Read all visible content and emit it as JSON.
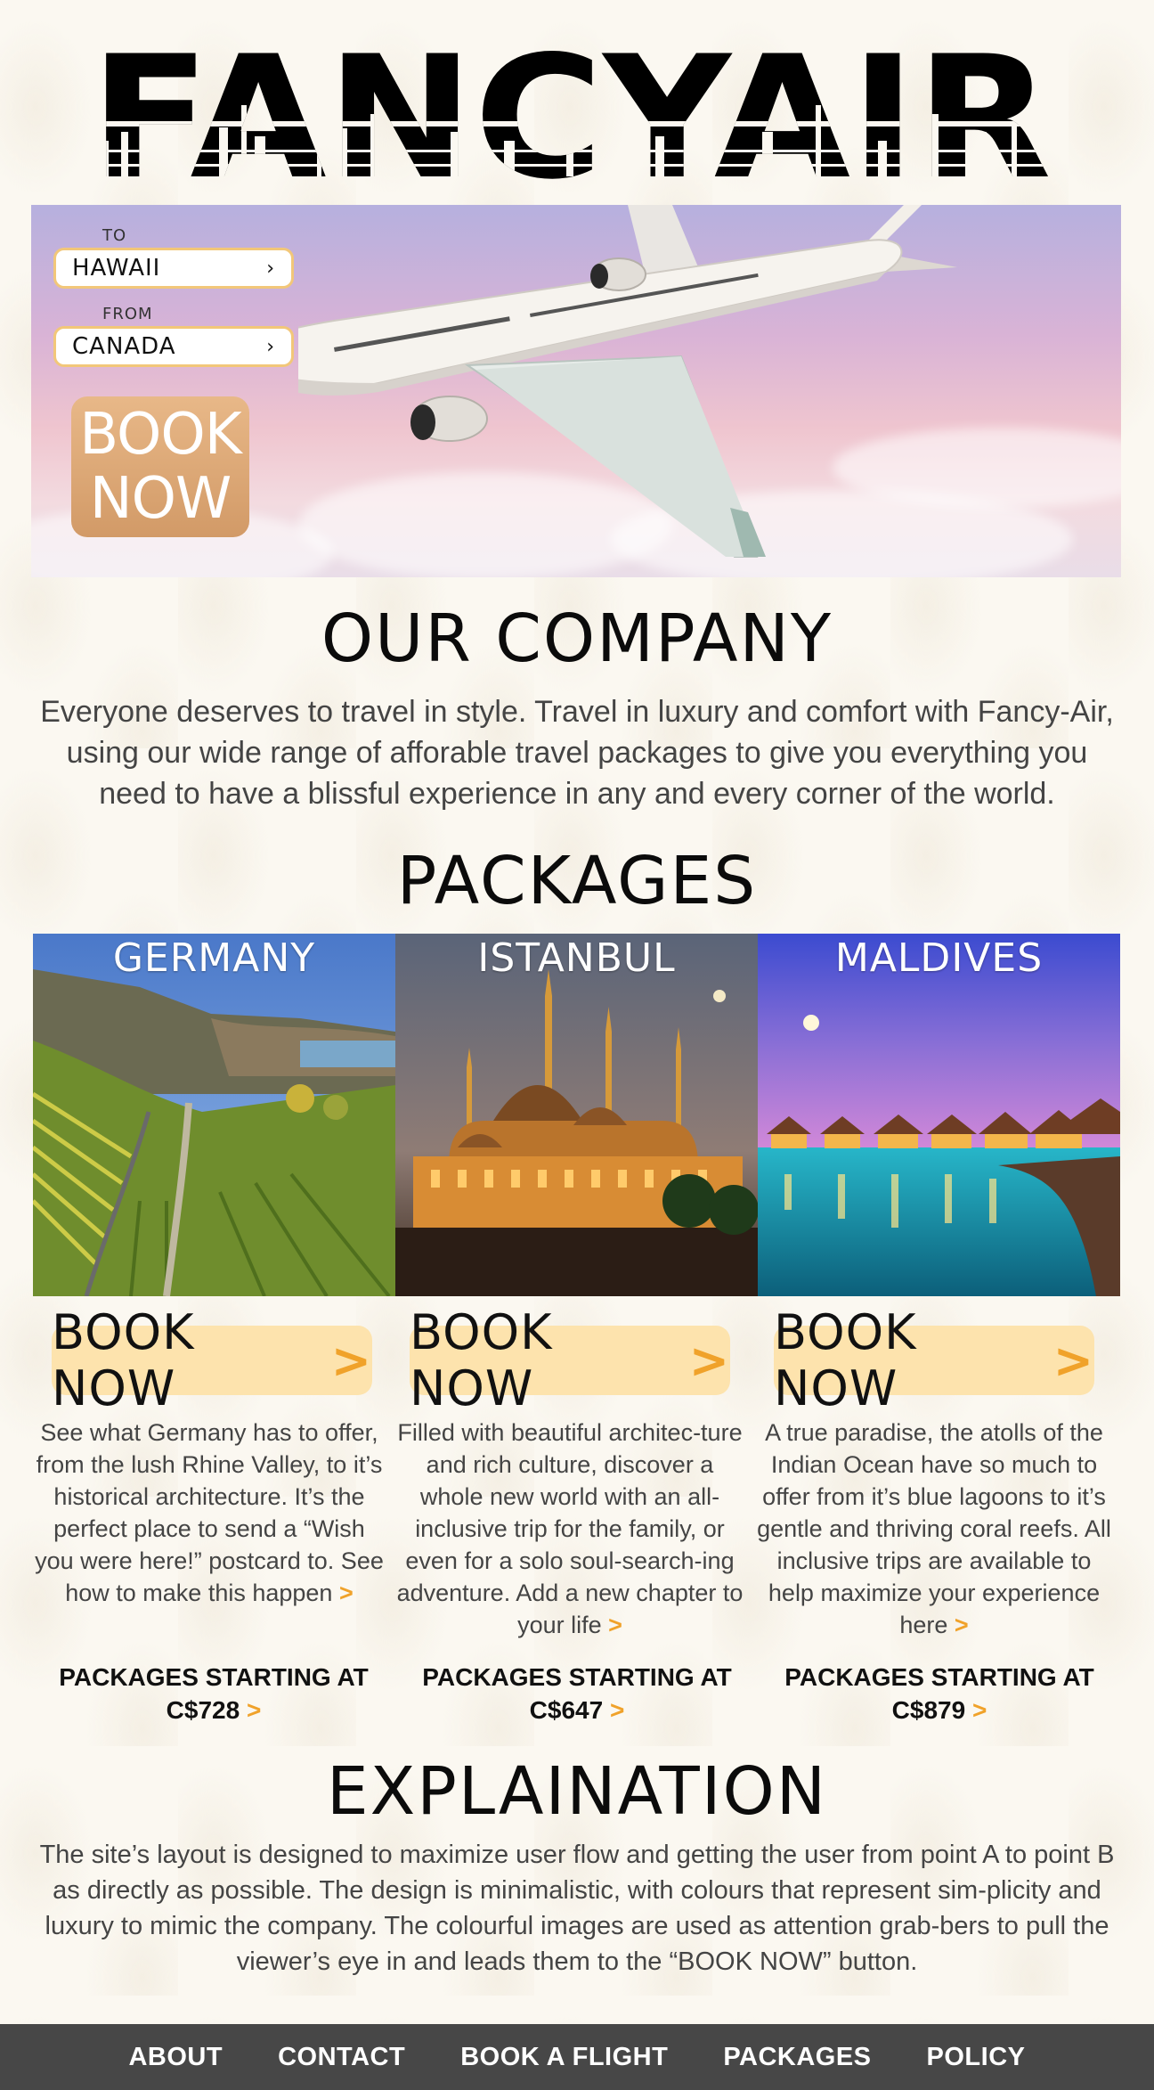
{
  "brand": {
    "logo_text": "FANCYAIR"
  },
  "hero": {
    "to_label": "TO",
    "to_value": "HAWAII",
    "from_label": "FROM",
    "from_value": "CANADA",
    "book_line1": "BOOK",
    "book_line2": "NOW"
  },
  "company": {
    "title": "OUR COMPANY",
    "body": "Everyone deserves to travel in style. Travel in luxury and comfort with Fancy-Air, using our wide range of afforable travel packages to give you everything you need to have a blissful experience in any and every corner of the world."
  },
  "packages": {
    "title": "PACKAGES",
    "items": [
      {
        "name": "GERMANY",
        "button": "BOOK NOW",
        "description": "See what Germany has to offer, from the lush Rhine Valley, to it’s historical architecture. It’s the perfect place to send a “Wish you were here!” postcard to. See how to make this happen",
        "price_label": "PACKAGES STARTING AT",
        "price": "C$728"
      },
      {
        "name": "ISTANBUL",
        "button": "BOOK NOW",
        "description": "Filled with beautiful architec-ture and rich culture, discover a whole new world with an all-inclusive trip for the family, or even for a solo soul-search-ing adventure. Add a new chapter to your life",
        "price_label": "PACKAGES STARTING AT",
        "price": "C$647"
      },
      {
        "name": "MALDIVES",
        "button": "BOOK NOW",
        "description": "A true paradise, the atolls of the Indian Ocean have so much to offer from it’s blue lagoons to it’s gentle and thriving coral reefs. All inclusive trips are available to help maximize your experience here",
        "price_label": "PACKAGES STARTING AT",
        "price": "C$879"
      }
    ]
  },
  "explanation": {
    "title": "EXPLAINATION",
    "body": "The site’s layout is designed to maximize user flow and getting the user from point A to point B as directly as possible. The design is minimalistic, with colours that represent sim-plicity and luxury to mimic the company. The colourful images are used as attention grab-bers to pull the viewer’s eye in and leads them to the “BOOK NOW” button."
  },
  "footer": {
    "links": [
      "ABOUT",
      "CONTACT",
      "BOOK A FLIGHT",
      "PACKAGES",
      "POLICY"
    ]
  },
  "colors": {
    "accent": "#f0a22a",
    "button_bg": "#fde3ad",
    "footer_bg": "#474747",
    "page_bg": "#fbf8f1"
  }
}
